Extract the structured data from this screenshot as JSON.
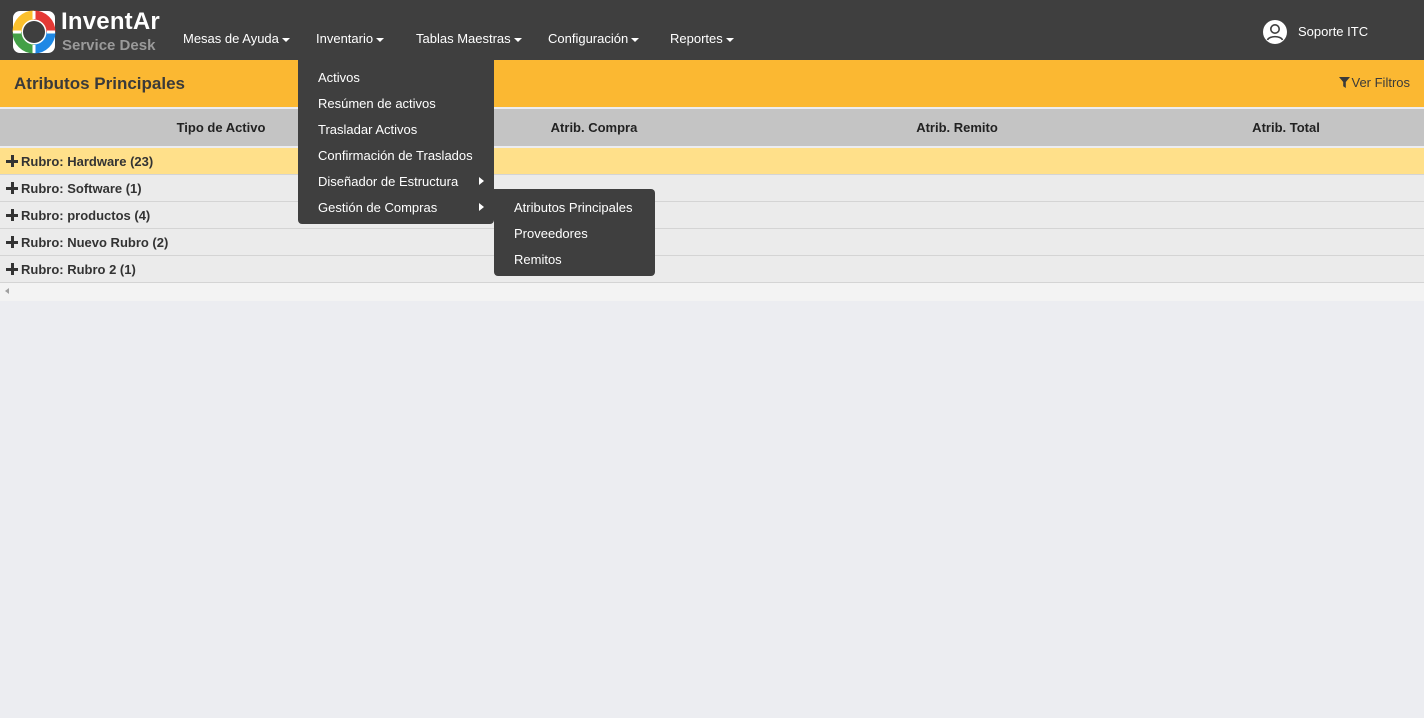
{
  "brand": {
    "name": "InventAr",
    "subtitle": "Service Desk"
  },
  "nav": {
    "items": [
      {
        "label": "Mesas de Ayuda"
      },
      {
        "label": "Inventario"
      },
      {
        "label": "Tablas Maestras"
      },
      {
        "label": "Configuración"
      },
      {
        "label": "Reportes"
      }
    ]
  },
  "user": {
    "name": "Soporte ITC",
    "icon": "user-circle-icon"
  },
  "page": {
    "title": "Atributos Principales",
    "filters_label": "Ver Filtros",
    "filters_icon": "filter-icon"
  },
  "grid": {
    "columns": [
      "Tipo de Activo",
      "Atrib. Compra",
      "Atrib. Remito",
      "Atrib. Total"
    ],
    "groups": [
      {
        "label": "Rubro: Hardware (23)"
      },
      {
        "label": "Rubro: Software (1)"
      },
      {
        "label": "Rubro: productos (4)"
      },
      {
        "label": "Rubro: Nuevo Rubro (2)"
      },
      {
        "label": "Rubro: Rubro 2 (1)"
      }
    ]
  },
  "inventario_menu": {
    "items": [
      {
        "label": "Activos"
      },
      {
        "label": "Resúmen de activos"
      },
      {
        "label": "Trasladar Activos"
      },
      {
        "label": "Confirmación de Traslados"
      },
      {
        "label": "Diseñador de Estructura"
      },
      {
        "label": "Gestión de Compras"
      }
    ]
  },
  "compras_submenu": {
    "items": [
      {
        "label": "Atributos Principales"
      },
      {
        "label": "Proveedores"
      },
      {
        "label": "Remitos"
      }
    ]
  },
  "colors": {
    "navbar": "#3f3f3f",
    "accent": "#fbb832",
    "active_row": "#ffe08a",
    "header": "#c4c4c4"
  }
}
